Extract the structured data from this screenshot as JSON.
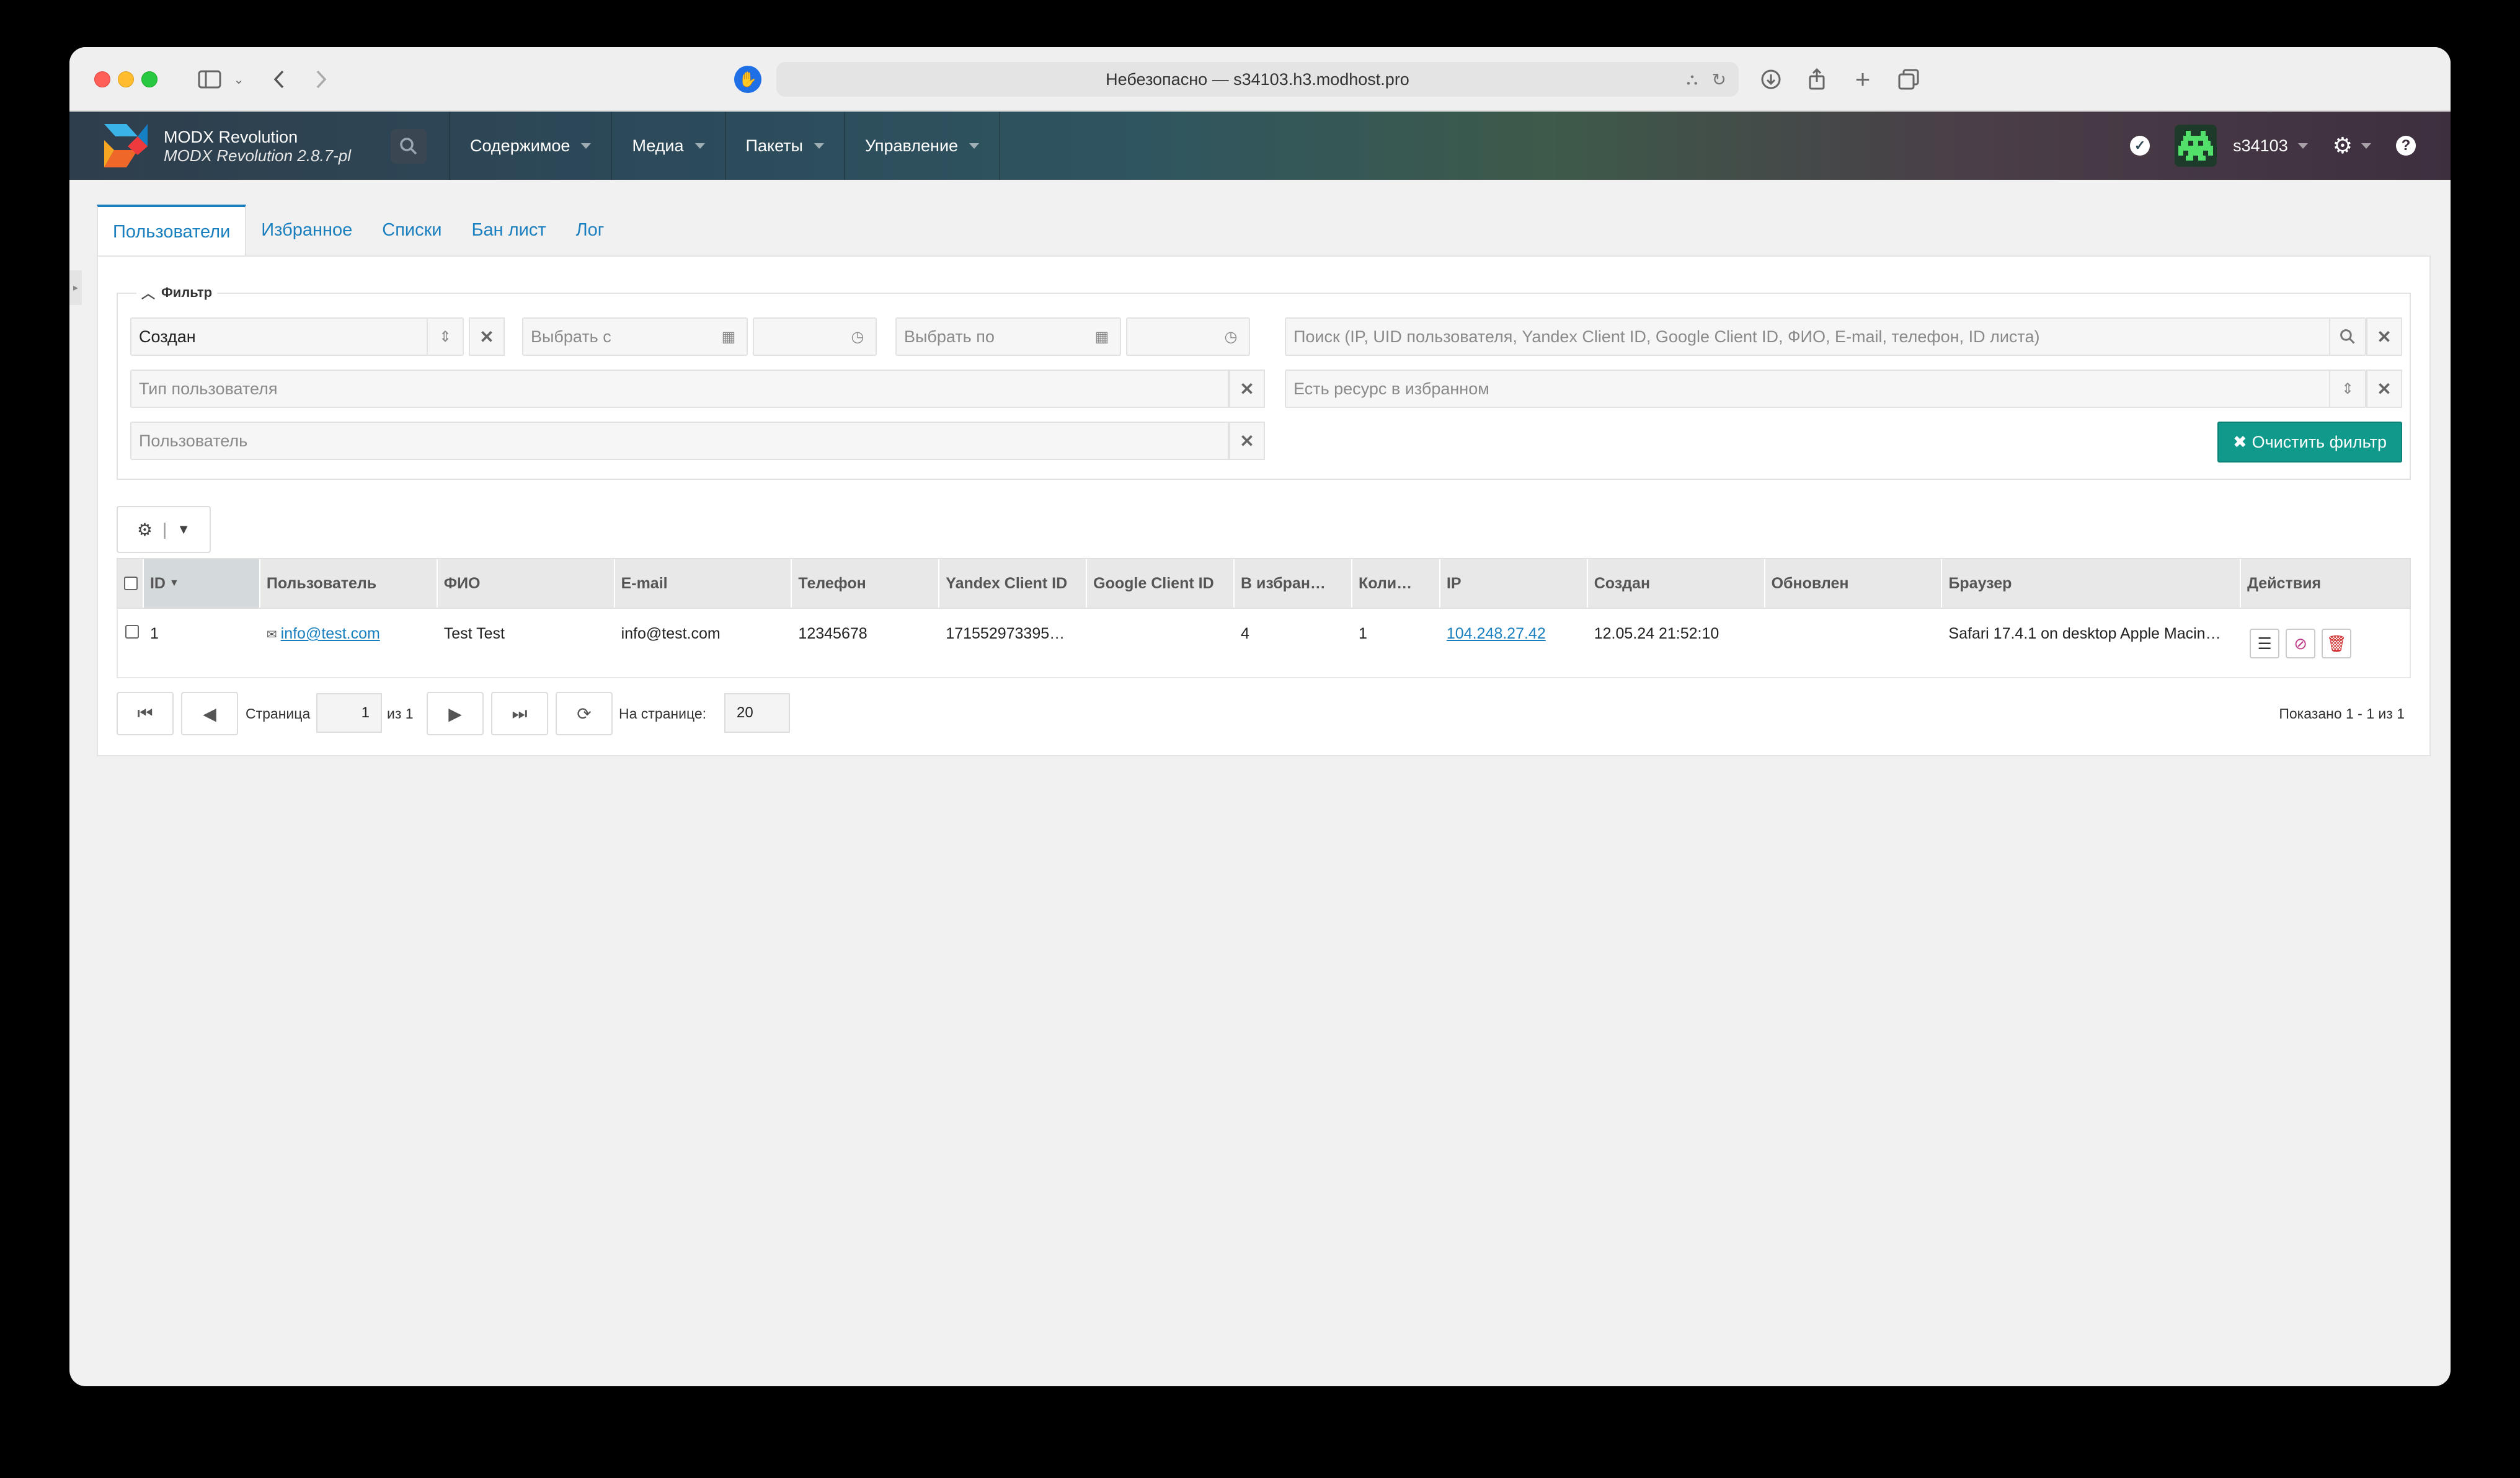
{
  "browser": {
    "url": "Небезопасно — s34103.h3.modhost.pro"
  },
  "header": {
    "app_name": "MODX Revolution",
    "app_version": "MODX Revolution 2.8.7-pl",
    "nav": [
      "Содержимое",
      "Медиа",
      "Пакеты",
      "Управление"
    ],
    "username": "s34103"
  },
  "tabs": [
    "Пользователи",
    "Избранное",
    "Списки",
    "Бан лист",
    "Лог"
  ],
  "filter": {
    "legend": "Фильтр",
    "date_field_value": "Создан",
    "date_from_placeholder": "Выбрать с",
    "date_to_placeholder": "Выбрать по",
    "search_placeholder": "Поиск (IP, UID пользователя, Yandex Client ID, Google Client ID, ФИО, E-mail, телефон, ID листа)",
    "user_type_placeholder": "Тип пользователя",
    "favorite_resource_placeholder": "Есть ресурс в избранном",
    "user_placeholder": "Пользователь",
    "clear_button": "Очистить фильтр"
  },
  "grid": {
    "columns": [
      "ID",
      "Пользователь",
      "ФИО",
      "E-mail",
      "Телефон",
      "Yandex Client ID",
      "Google Client ID",
      "В избран…",
      "Коли…",
      "IP",
      "Создан",
      "Обновлен",
      "Браузер",
      "Действия"
    ],
    "rows": [
      {
        "id": "1",
        "user": "info@test.com",
        "fio": "Test Test",
        "email": "info@test.com",
        "phone": "12345678",
        "yandex": "171552973395…",
        "google": "",
        "favorites": "4",
        "count": "1",
        "ip": "104.248.27.42",
        "created": "12.05.24 21:52:10",
        "updated": "",
        "browser": "Safari 17.4.1 on desktop Apple Macin…"
      }
    ]
  },
  "pager": {
    "page_label": "Страница",
    "page_value": "1",
    "of_label": "из 1",
    "per_page_label": "На странице:",
    "per_page_value": "20",
    "shown": "Показано 1 - 1 из 1"
  }
}
